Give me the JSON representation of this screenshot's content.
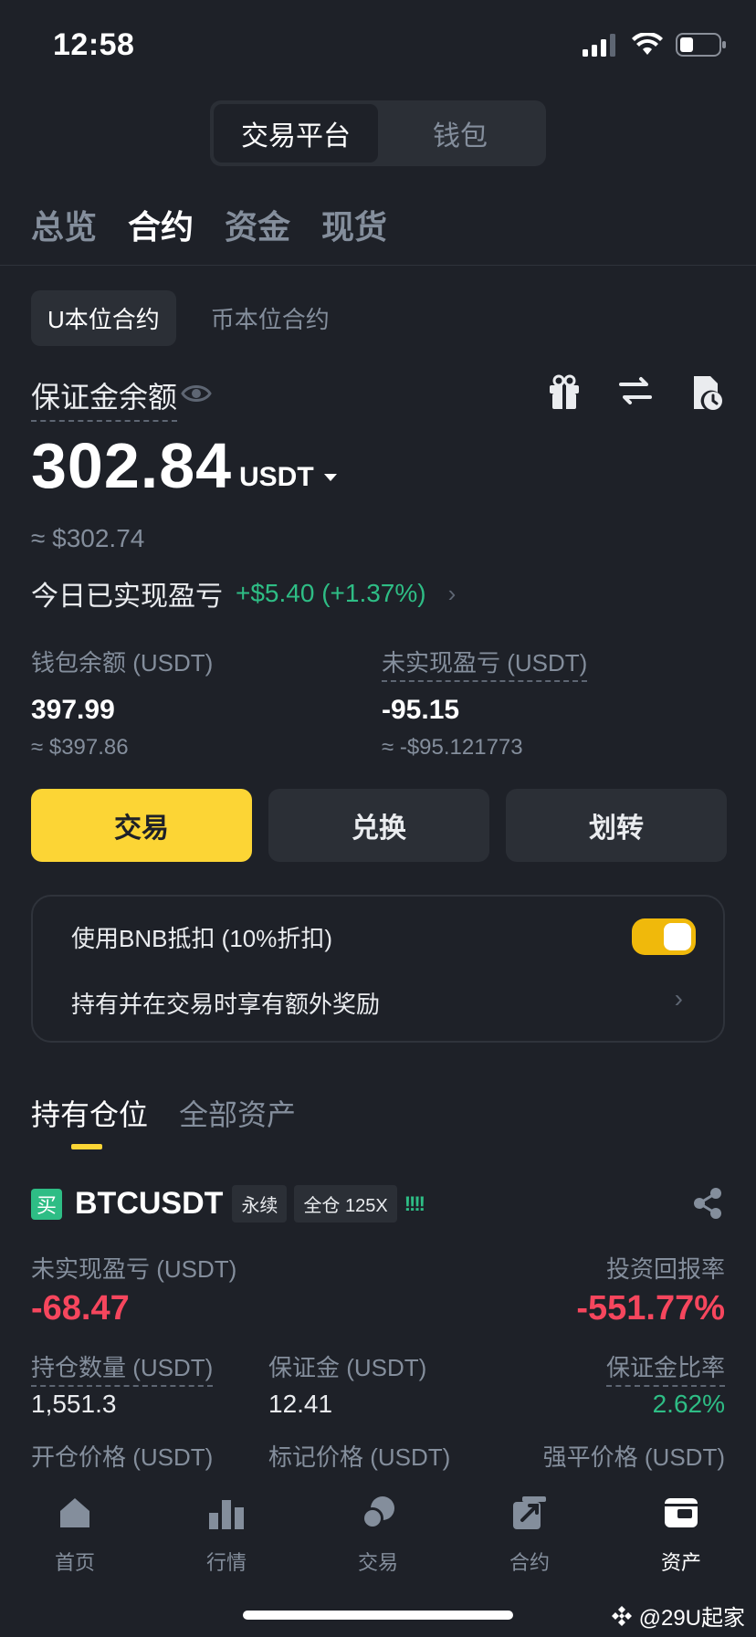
{
  "status": {
    "time": "12:58"
  },
  "segment": {
    "left": "交易平台",
    "right": "钱包"
  },
  "tabs": [
    "总览",
    "合约",
    "资金",
    "现货"
  ],
  "subtabs": [
    "U本位合约",
    "币本位合约"
  ],
  "margin": {
    "label": "保证金余额",
    "balance": "302.84",
    "unit": "USDT",
    "approx": "≈ $302.74",
    "today_pnl_label": "今日已实现盈亏",
    "today_pnl_value": "+$5.40 (+1.37%)"
  },
  "wallet": {
    "label": "钱包余额 (USDT)",
    "value": "397.99",
    "approx": "≈ $397.86"
  },
  "unrealized": {
    "label": "未实现盈亏 (USDT)",
    "value": "-95.15",
    "approx": "≈ -$95.121773"
  },
  "buttons": {
    "trade": "交易",
    "convert": "兑换",
    "transfer": "划转"
  },
  "bnb": {
    "row1": "使用BNB抵扣 (10%折扣)",
    "row2": "持有并在交易时享有额外奖励",
    "toggle_on": true
  },
  "positions": {
    "tabs": [
      "持有仓位",
      "全部资产"
    ],
    "buy_tag": "买",
    "symbol": "BTCUSDT",
    "chip_perp": "永续",
    "chip_cross": "全仓 125X",
    "bars": "!!!!",
    "pnl_label": "未实现盈亏 (USDT)",
    "pnl_value": "-68.47",
    "roe_label": "投资回报率",
    "roe_value": "-551.77%",
    "size_label": "持仓数量 (USDT)",
    "size_value": "1,551.3",
    "margin_label": "保证金 (USDT)",
    "margin_value": "12.41",
    "ratio_label": "保证金比率",
    "ratio_value": "2.62%",
    "entry_label": "开仓价格 (USDT)",
    "mark_label": "标记价格 (USDT)",
    "liq_label": "强平价格 (USDT)"
  },
  "nav": [
    "首页",
    "行情",
    "交易",
    "合约",
    "资产"
  ],
  "watermark": "@29U起家",
  "colors": {
    "accent": "#fcd535",
    "up": "#2ebd85",
    "down": "#f6465d",
    "bg": "#1e2128"
  }
}
